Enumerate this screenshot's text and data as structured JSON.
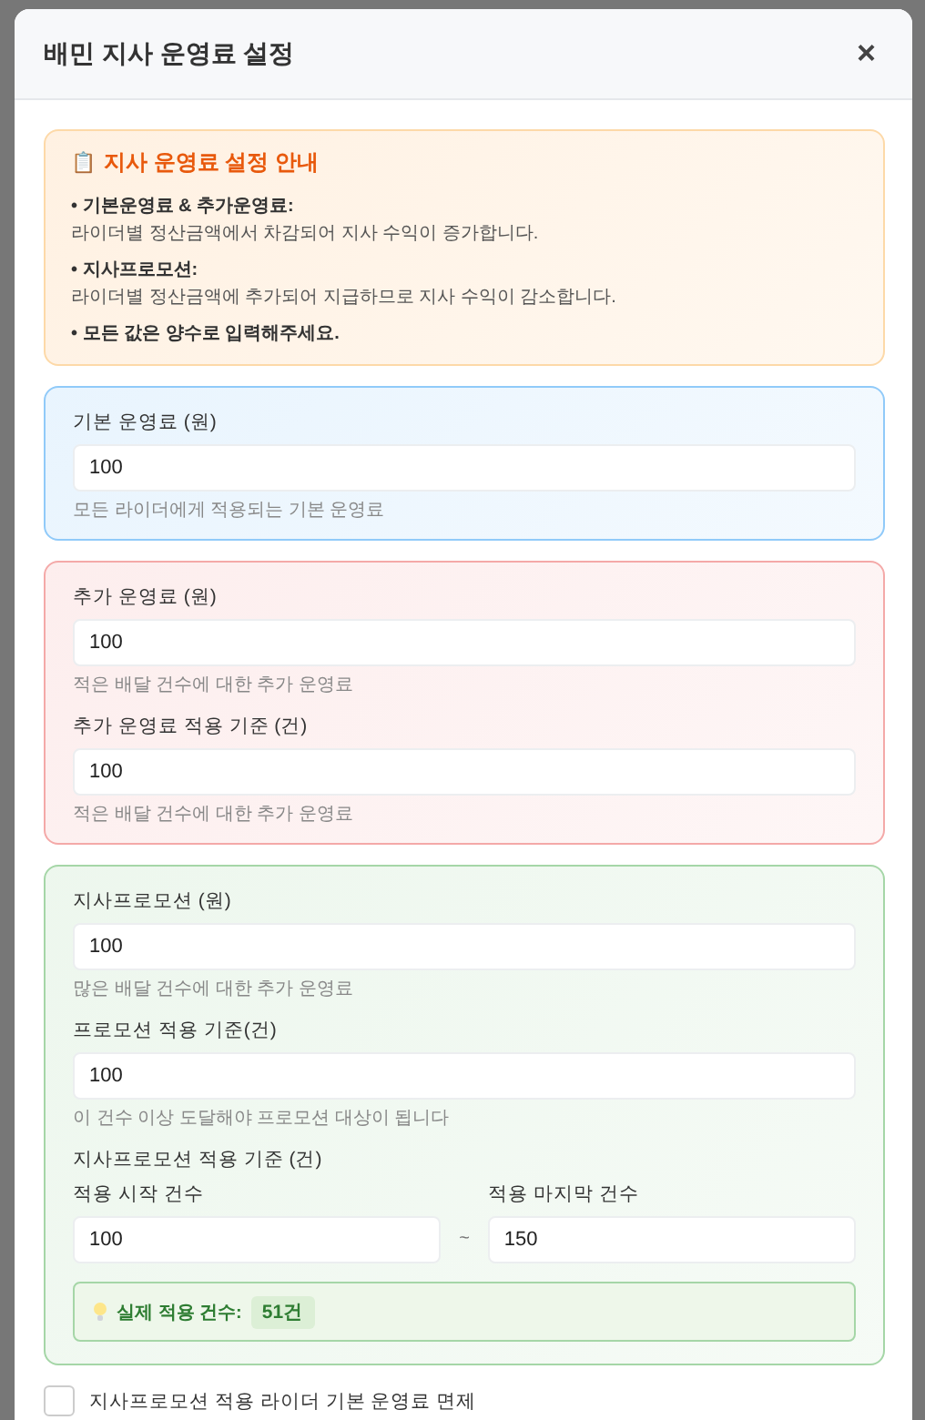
{
  "dialog": {
    "title": "배민 지사 운영료 설정",
    "close": "×"
  },
  "notice": {
    "icon": "📋",
    "title": "지사 운영료 설정 안내",
    "items": [
      {
        "heading": "• 기본운영료 & 추가운영료:",
        "text": "라이더별 정산금액에서 차감되어 지사 수익이 증가합니다."
      },
      {
        "heading": "• 지사프로모션:",
        "text": "라이더별 정산금액에 추가되어 지급하므로 지사 수익이 감소합니다."
      }
    ],
    "note": "• 모든 값은 양수로 입력해주세요."
  },
  "sections": [
    {
      "color": "#90caf9",
      "fields": [
        {
          "kind": "field",
          "label": "기본 운영료 (원)",
          "value": "100",
          "help": "모든 라이더에게 적용되는 기본 운영료"
        }
      ]
    },
    {
      "color": "#f4a9a8",
      "fields": [
        {
          "kind": "field",
          "label": "추가 운영료 (원)",
          "value": "100",
          "help": "적은 배달 건수에 대한 추가 운영료"
        },
        {
          "kind": "field",
          "label": "추가 운영료 적용 기준 (건)",
          "value": "100",
          "help": "적은 배달 건수에 대한 추가 운영료"
        }
      ]
    },
    {
      "color": "#a5d6a7",
      "fields": [
        {
          "kind": "field",
          "label": "지사프로모션 (원)",
          "value": "100",
          "help": "많은 배달 건수에 대한 추가 운영료"
        },
        {
          "kind": "field",
          "label": "프로모션 적용 기준(건)",
          "value": "100",
          "help": "이 건수 이상 도달해야 프로모션 대상이 됩니다"
        },
        {
          "kind": "range",
          "label": "지사프로모션 적용 기준 (건)",
          "start_label": "적용 시작 건수",
          "start": "100",
          "separator": "~",
          "end_label": "적용 마지막 건수",
          "end": "150"
        },
        {
          "kind": "result",
          "label": "실제 적용 건수:",
          "value": "51건"
        }
      ]
    }
  ],
  "checkbox": {
    "label": "지사프로모션 적용 라이더 기본 운영료 면제",
    "checked": false
  }
}
